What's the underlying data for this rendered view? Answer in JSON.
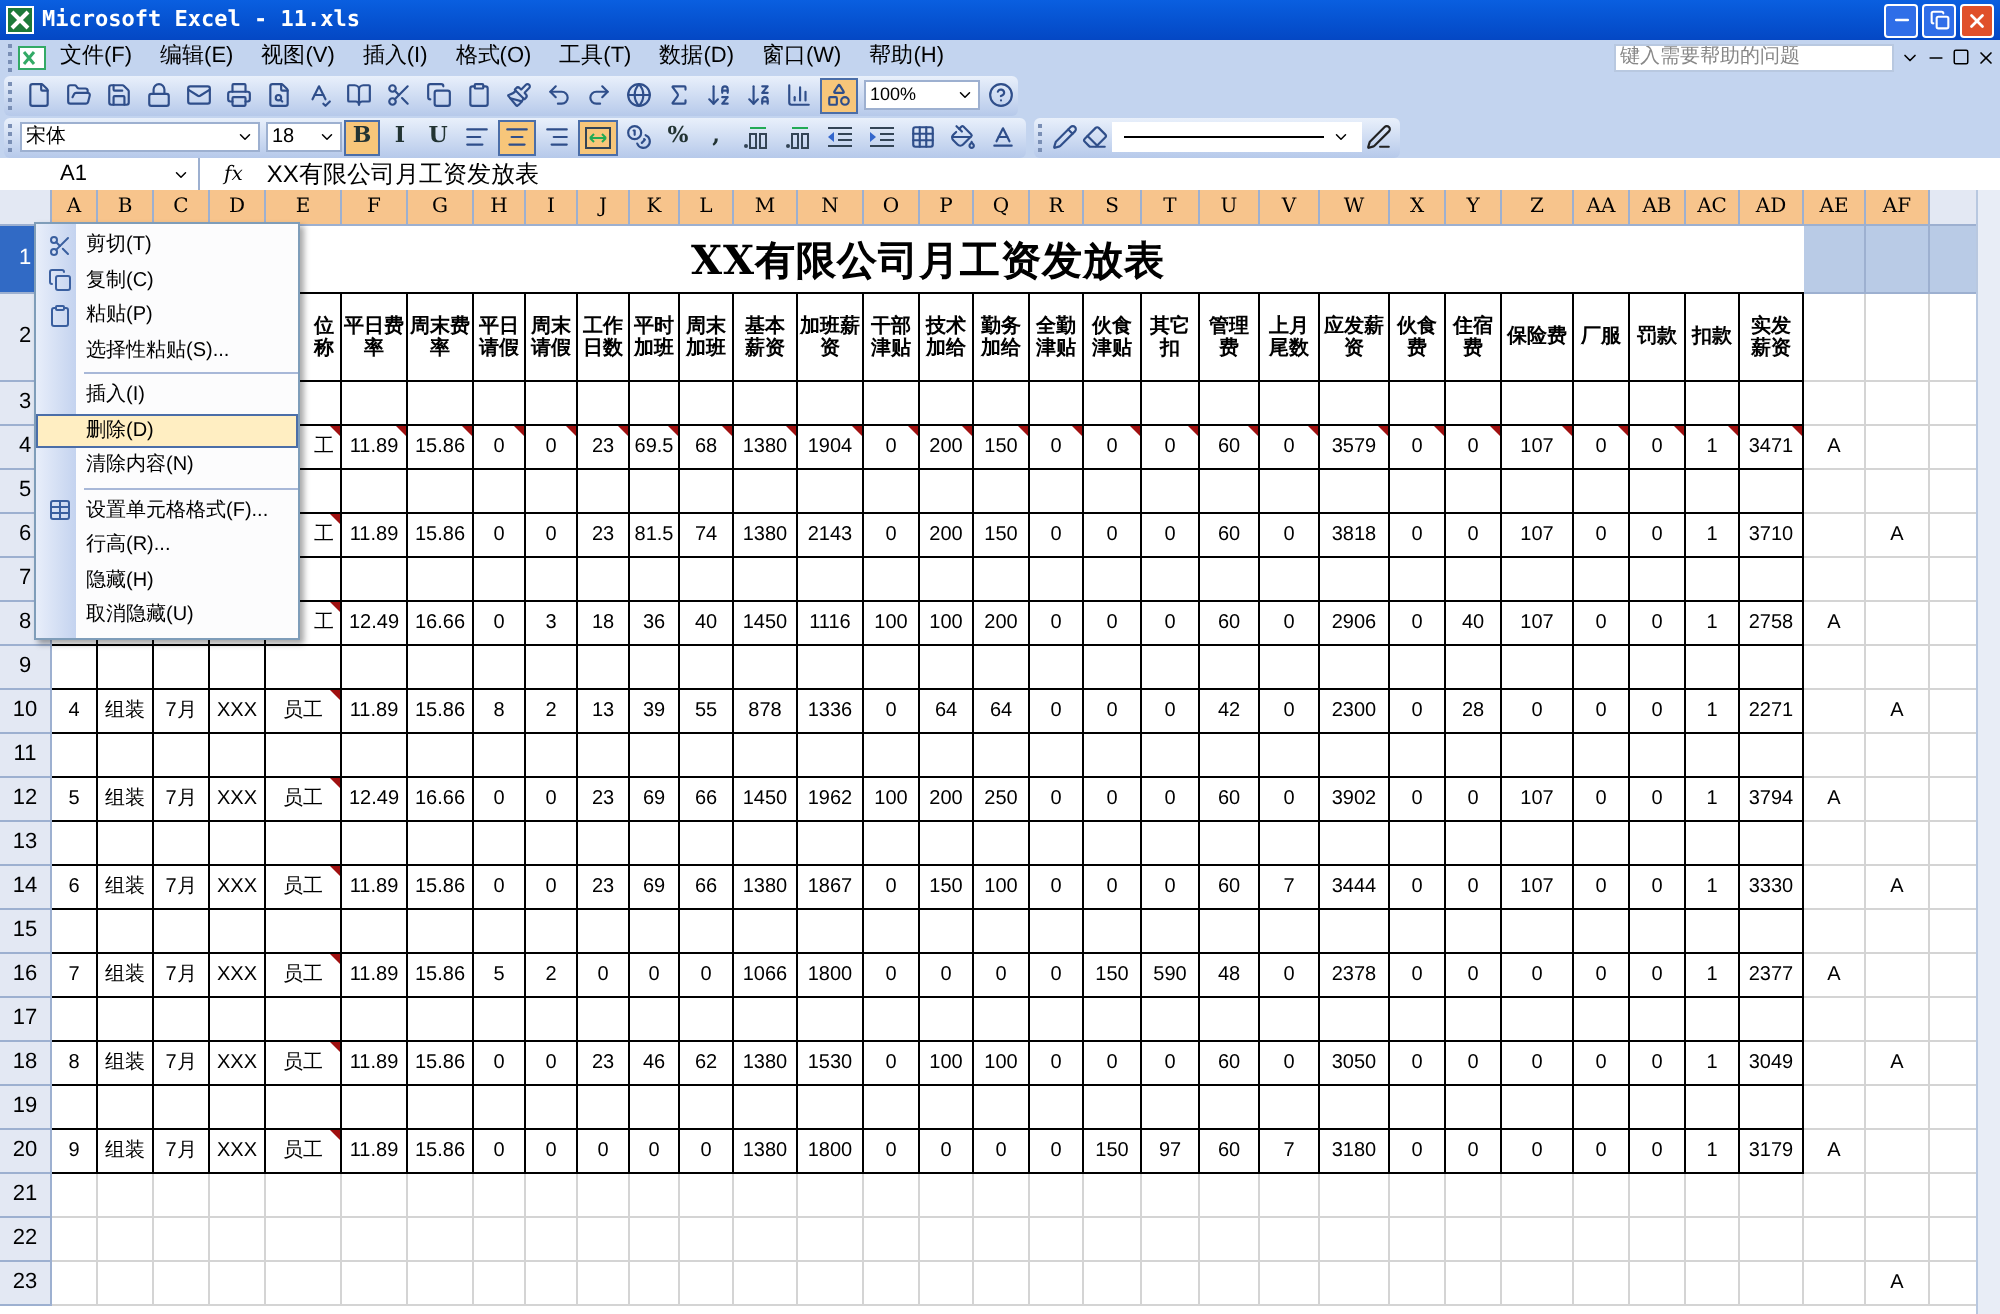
{
  "window": {
    "title": "Microsoft Excel - 11.xls"
  },
  "menu_bar": [
    "文件(F)",
    "编辑(E)",
    "视图(V)",
    "插入(I)",
    "格式(O)",
    "工具(T)",
    "数据(D)",
    "窗口(W)",
    "帮助(H)"
  ],
  "help_box": {
    "placeholder": "键入需要帮助的问题"
  },
  "standard_toolbar": [
    {
      "kind": "new",
      "pressed": false
    },
    {
      "kind": "open",
      "pressed": false
    },
    {
      "kind": "save",
      "pressed": false
    },
    {
      "kind": "permission",
      "pressed": false
    },
    {
      "kind": "mail",
      "pressed": false
    },
    {
      "kind": "print",
      "pressed": false
    },
    {
      "kind": "preview",
      "pressed": false
    },
    {
      "kind": "spelling",
      "pressed": false
    },
    {
      "kind": "research",
      "pressed": false
    },
    {
      "kind": "cut",
      "pressed": false
    },
    {
      "kind": "copy",
      "pressed": false
    },
    {
      "kind": "paste",
      "pressed": false
    },
    {
      "kind": "painter",
      "pressed": false
    },
    {
      "kind": "undo",
      "pressed": false
    },
    {
      "kind": "redo",
      "pressed": false
    },
    {
      "kind": "link",
      "pressed": false
    },
    {
      "kind": "sum",
      "pressed": false
    },
    {
      "kind": "sort-asc",
      "pressed": false
    },
    {
      "kind": "sort-desc",
      "pressed": false
    },
    {
      "kind": "chart",
      "pressed": false
    },
    {
      "kind": "drawing",
      "pressed": true
    }
  ],
  "zoom": "100%",
  "format_toolbar": {
    "font": "宋体",
    "size": "18",
    "buttons": [
      {
        "kind": "text",
        "label": "B",
        "pressed": true
      },
      {
        "kind": "text",
        "label": "I",
        "pressed": false
      },
      {
        "kind": "text",
        "label": "U",
        "pressed": false
      },
      {
        "kind": "align-left",
        "pressed": false
      },
      {
        "kind": "align-center",
        "pressed": true
      },
      {
        "kind": "align-right",
        "pressed": false
      },
      {
        "kind": "merge",
        "pressed": true
      },
      {
        "kind": "currency",
        "pressed": false
      },
      {
        "kind": "text",
        "label": "%",
        "pressed": false
      },
      {
        "kind": "text",
        "label": ",",
        "pressed": false
      },
      {
        "kind": "decimal-up",
        "pressed": false
      },
      {
        "kind": "decimal-down",
        "pressed": false
      },
      {
        "kind": "outdent",
        "pressed": false
      },
      {
        "kind": "indent",
        "pressed": false
      },
      {
        "kind": "borders",
        "pressed": false
      },
      {
        "kind": "fill",
        "pressed": false
      },
      {
        "kind": "font-color",
        "pressed": false
      }
    ]
  },
  "formula_bar": {
    "cell": "A1",
    "function_label": "fx",
    "value": "XX有限公司月工资发放表"
  },
  "columns": [
    "A",
    "B",
    "C",
    "D",
    "E",
    "F",
    "G",
    "H",
    "I",
    "J",
    "K",
    "L",
    "M",
    "N",
    "O",
    "P",
    "Q",
    "R",
    "S",
    "T",
    "U",
    "V",
    "W",
    "X",
    "Y",
    "Z",
    "AA",
    "AB",
    "AC",
    "AD",
    "AE",
    "AF"
  ],
  "row_numbers": [
    "2",
    "3",
    "4",
    "5",
    "6",
    "7",
    "8",
    "9",
    "10",
    "11",
    "12",
    "13",
    "14",
    "15",
    "16",
    "17",
    "18",
    "19",
    "20",
    "21",
    "22",
    "23"
  ],
  "selected_row": {
    "number": "1",
    "selected": true
  },
  "sheet_title": "XX有限公司月工资发放表",
  "header_position": "位称",
  "headers": [
    "平日费率",
    "周末费率",
    "平日请假",
    "周末请假",
    "工作日数",
    "平时加班",
    "周末加班",
    "基本薪资",
    "加班薪资",
    "干部津贴",
    "技术加给",
    "勤务加给",
    "全勤津贴",
    "伙食津贴",
    "其它扣",
    "管理费",
    "上月尾数",
    "应发薪资",
    "伙食费",
    "住宿费",
    "保险费",
    "厂服",
    "罚款",
    "扣款",
    "实发薪资"
  ],
  "data_rows": [
    {
      "position": "工",
      "position_note": true,
      "value_notes": true,
      "values": [
        "11.89",
        "15.86",
        "0",
        "0",
        "23",
        "69.5",
        "68",
        "1380",
        "1904",
        "0",
        "200",
        "150",
        "0",
        "0",
        "0",
        "60",
        "0",
        "3579",
        "0",
        "0",
        "107",
        "0",
        "0",
        "1",
        "3471"
      ],
      "column_ae": "A"
    },
    {
      "position": "工",
      "position_note": true,
      "value_notes": false,
      "values": [
        "11.89",
        "15.86",
        "0",
        "0",
        "23",
        "81.5",
        "74",
        "1380",
        "2143",
        "0",
        "200",
        "150",
        "0",
        "0",
        "0",
        "60",
        "0",
        "3818",
        "0",
        "0",
        "107",
        "0",
        "0",
        "1",
        "3710"
      ],
      "column_af": "A"
    },
    {
      "position": "工",
      "position_note": true,
      "value_notes": false,
      "values": [
        "12.49",
        "16.66",
        "0",
        "3",
        "18",
        "36",
        "40",
        "1450",
        "1116",
        "100",
        "100",
        "200",
        "0",
        "0",
        "0",
        "60",
        "0",
        "2906",
        "0",
        "40",
        "107",
        "0",
        "0",
        "1",
        "2758"
      ],
      "column_ae": "A"
    },
    {
      "number": "4",
      "department": "组装",
      "month": "7月",
      "name": "XXX",
      "position": "员工",
      "position_note": true,
      "value_notes": false,
      "values": [
        "11.89",
        "15.86",
        "8",
        "2",
        "13",
        "39",
        "55",
        "878",
        "1336",
        "0",
        "64",
        "64",
        "0",
        "0",
        "0",
        "42",
        "0",
        "2300",
        "0",
        "28",
        "0",
        "0",
        "0",
        "1",
        "2271"
      ],
      "column_af": "A"
    },
    {
      "number": "5",
      "department": "组装",
      "month": "7月",
      "name": "XXX",
      "position": "员工",
      "position_note": true,
      "value_notes": false,
      "values": [
        "12.49",
        "16.66",
        "0",
        "0",
        "23",
        "69",
        "66",
        "1450",
        "1962",
        "100",
        "200",
        "250",
        "0",
        "0",
        "0",
        "60",
        "0",
        "3902",
        "0",
        "0",
        "107",
        "0",
        "0",
        "1",
        "3794"
      ],
      "column_ae": "A"
    },
    {
      "number": "6",
      "department": "组装",
      "month": "7月",
      "name": "XXX",
      "position": "员工",
      "position_note": true,
      "value_notes": false,
      "values": [
        "11.89",
        "15.86",
        "0",
        "0",
        "23",
        "69",
        "66",
        "1380",
        "1867",
        "0",
        "150",
        "100",
        "0",
        "0",
        "0",
        "60",
        "7",
        "3444",
        "0",
        "0",
        "107",
        "0",
        "0",
        "1",
        "3330"
      ],
      "column_af": "A"
    },
    {
      "number": "7",
      "department": "组装",
      "month": "7月",
      "name": "XXX",
      "position": "员工",
      "position_note": true,
      "value_notes": false,
      "values": [
        "11.89",
        "15.86",
        "5",
        "2",
        "0",
        "0",
        "0",
        "1066",
        "1800",
        "0",
        "0",
        "0",
        "0",
        "150",
        "590",
        "48",
        "0",
        "2378",
        "0",
        "0",
        "0",
        "0",
        "0",
        "1",
        "2377"
      ],
      "column_ae": "A"
    },
    {
      "number": "8",
      "department": "组装",
      "month": "7月",
      "name": "XXX",
      "position": "员工",
      "position_note": true,
      "value_notes": false,
      "values": [
        "11.89",
        "15.86",
        "0",
        "0",
        "23",
        "46",
        "62",
        "1380",
        "1530",
        "0",
        "100",
        "100",
        "0",
        "0",
        "0",
        "60",
        "0",
        "3050",
        "0",
        "0",
        "0",
        "0",
        "0",
        "1",
        "3049"
      ],
      "column_af": "A"
    },
    {
      "number": "9",
      "department": "组装",
      "month": "7月",
      "name": "XXX",
      "position": "员工",
      "position_note": true,
      "value_notes": false,
      "values": [
        "11.89",
        "15.86",
        "0",
        "0",
        "0",
        "0",
        "0",
        "1380",
        "1800",
        "0",
        "0",
        "0",
        "0",
        "150",
        "97",
        "60",
        "7",
        "3180",
        "0",
        "0",
        "0",
        "0",
        "0",
        "1",
        "3179"
      ],
      "column_ae": "A"
    }
  ],
  "extra_row": {
    "column_af": "A"
  },
  "context_menu": [
    {
      "kind": "item",
      "label": "剪切(T)",
      "selected": false
    },
    {
      "kind": "item",
      "label": "复制(C)",
      "selected": false
    },
    {
      "kind": "item",
      "label": "粘贴(P)",
      "selected": false
    },
    {
      "kind": "item",
      "label": "选择性粘贴(S)...",
      "selected": false
    },
    {
      "kind": "separator"
    },
    {
      "kind": "item",
      "label": "插入(I)",
      "selected": false
    },
    {
      "kind": "item",
      "label": "删除(D)",
      "selected": true
    },
    {
      "kind": "item",
      "label": "清除内容(N)",
      "selected": false
    },
    {
      "kind": "separator"
    },
    {
      "kind": "item",
      "label": "设置单元格格式(F)...",
      "selected": false
    },
    {
      "kind": "item",
      "label": "行高(R)...",
      "selected": false
    },
    {
      "kind": "item",
      "label": "隐藏(H)",
      "selected": false
    },
    {
      "kind": "item",
      "label": "取消隐藏(U)",
      "selected": false
    }
  ]
}
